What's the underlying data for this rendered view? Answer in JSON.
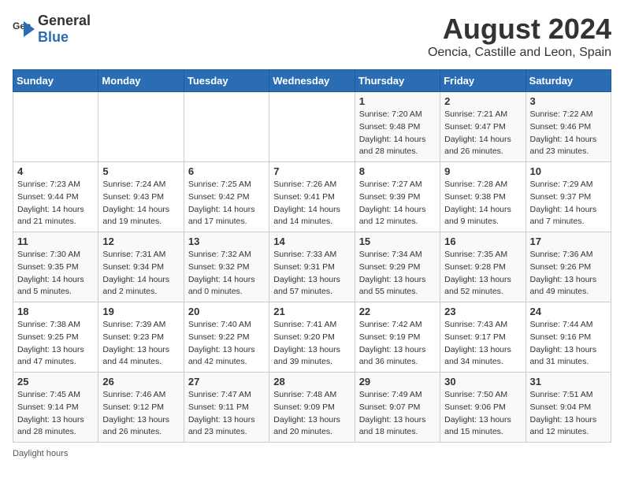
{
  "header": {
    "logo_general": "General",
    "logo_blue": "Blue",
    "title": "August 2024",
    "subtitle": "Oencia, Castille and Leon, Spain"
  },
  "days_of_week": [
    "Sunday",
    "Monday",
    "Tuesday",
    "Wednesday",
    "Thursday",
    "Friday",
    "Saturday"
  ],
  "weeks": [
    [
      {
        "day": "",
        "info": ""
      },
      {
        "day": "",
        "info": ""
      },
      {
        "day": "",
        "info": ""
      },
      {
        "day": "",
        "info": ""
      },
      {
        "day": "1",
        "info": "Sunrise: 7:20 AM\nSunset: 9:48 PM\nDaylight: 14 hours\nand 28 minutes."
      },
      {
        "day": "2",
        "info": "Sunrise: 7:21 AM\nSunset: 9:47 PM\nDaylight: 14 hours\nand 26 minutes."
      },
      {
        "day": "3",
        "info": "Sunrise: 7:22 AM\nSunset: 9:46 PM\nDaylight: 14 hours\nand 23 minutes."
      }
    ],
    [
      {
        "day": "4",
        "info": "Sunrise: 7:23 AM\nSunset: 9:44 PM\nDaylight: 14 hours\nand 21 minutes."
      },
      {
        "day": "5",
        "info": "Sunrise: 7:24 AM\nSunset: 9:43 PM\nDaylight: 14 hours\nand 19 minutes."
      },
      {
        "day": "6",
        "info": "Sunrise: 7:25 AM\nSunset: 9:42 PM\nDaylight: 14 hours\nand 17 minutes."
      },
      {
        "day": "7",
        "info": "Sunrise: 7:26 AM\nSunset: 9:41 PM\nDaylight: 14 hours\nand 14 minutes."
      },
      {
        "day": "8",
        "info": "Sunrise: 7:27 AM\nSunset: 9:39 PM\nDaylight: 14 hours\nand 12 minutes."
      },
      {
        "day": "9",
        "info": "Sunrise: 7:28 AM\nSunset: 9:38 PM\nDaylight: 14 hours\nand 9 minutes."
      },
      {
        "day": "10",
        "info": "Sunrise: 7:29 AM\nSunset: 9:37 PM\nDaylight: 14 hours\nand 7 minutes."
      }
    ],
    [
      {
        "day": "11",
        "info": "Sunrise: 7:30 AM\nSunset: 9:35 PM\nDaylight: 14 hours\nand 5 minutes."
      },
      {
        "day": "12",
        "info": "Sunrise: 7:31 AM\nSunset: 9:34 PM\nDaylight: 14 hours\nand 2 minutes."
      },
      {
        "day": "13",
        "info": "Sunrise: 7:32 AM\nSunset: 9:32 PM\nDaylight: 14 hours\nand 0 minutes."
      },
      {
        "day": "14",
        "info": "Sunrise: 7:33 AM\nSunset: 9:31 PM\nDaylight: 13 hours\nand 57 minutes."
      },
      {
        "day": "15",
        "info": "Sunrise: 7:34 AM\nSunset: 9:29 PM\nDaylight: 13 hours\nand 55 minutes."
      },
      {
        "day": "16",
        "info": "Sunrise: 7:35 AM\nSunset: 9:28 PM\nDaylight: 13 hours\nand 52 minutes."
      },
      {
        "day": "17",
        "info": "Sunrise: 7:36 AM\nSunset: 9:26 PM\nDaylight: 13 hours\nand 49 minutes."
      }
    ],
    [
      {
        "day": "18",
        "info": "Sunrise: 7:38 AM\nSunset: 9:25 PM\nDaylight: 13 hours\nand 47 minutes."
      },
      {
        "day": "19",
        "info": "Sunrise: 7:39 AM\nSunset: 9:23 PM\nDaylight: 13 hours\nand 44 minutes."
      },
      {
        "day": "20",
        "info": "Sunrise: 7:40 AM\nSunset: 9:22 PM\nDaylight: 13 hours\nand 42 minutes."
      },
      {
        "day": "21",
        "info": "Sunrise: 7:41 AM\nSunset: 9:20 PM\nDaylight: 13 hours\nand 39 minutes."
      },
      {
        "day": "22",
        "info": "Sunrise: 7:42 AM\nSunset: 9:19 PM\nDaylight: 13 hours\nand 36 minutes."
      },
      {
        "day": "23",
        "info": "Sunrise: 7:43 AM\nSunset: 9:17 PM\nDaylight: 13 hours\nand 34 minutes."
      },
      {
        "day": "24",
        "info": "Sunrise: 7:44 AM\nSunset: 9:16 PM\nDaylight: 13 hours\nand 31 minutes."
      }
    ],
    [
      {
        "day": "25",
        "info": "Sunrise: 7:45 AM\nSunset: 9:14 PM\nDaylight: 13 hours\nand 28 minutes."
      },
      {
        "day": "26",
        "info": "Sunrise: 7:46 AM\nSunset: 9:12 PM\nDaylight: 13 hours\nand 26 minutes."
      },
      {
        "day": "27",
        "info": "Sunrise: 7:47 AM\nSunset: 9:11 PM\nDaylight: 13 hours\nand 23 minutes."
      },
      {
        "day": "28",
        "info": "Sunrise: 7:48 AM\nSunset: 9:09 PM\nDaylight: 13 hours\nand 20 minutes."
      },
      {
        "day": "29",
        "info": "Sunrise: 7:49 AM\nSunset: 9:07 PM\nDaylight: 13 hours\nand 18 minutes."
      },
      {
        "day": "30",
        "info": "Sunrise: 7:50 AM\nSunset: 9:06 PM\nDaylight: 13 hours\nand 15 minutes."
      },
      {
        "day": "31",
        "info": "Sunrise: 7:51 AM\nSunset: 9:04 PM\nDaylight: 13 hours\nand 12 minutes."
      }
    ]
  ],
  "footer": {
    "daylight_label": "Daylight hours"
  }
}
